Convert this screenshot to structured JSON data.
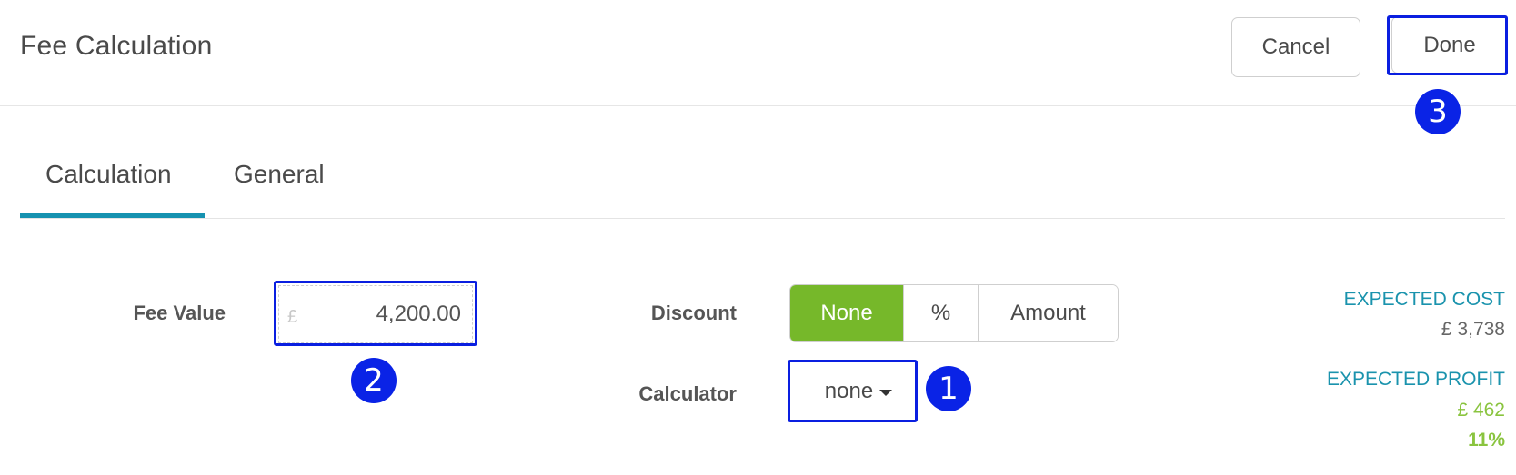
{
  "header": {
    "title": "Fee Calculation",
    "cancel_label": "Cancel",
    "done_label": "Done"
  },
  "tabs": [
    {
      "label": "Calculation",
      "active": true
    },
    {
      "label": "General",
      "active": false
    }
  ],
  "form": {
    "fee_value_label": "Fee Value",
    "fee_currency": "£",
    "fee_value": "4,200.00",
    "discount_label": "Discount",
    "discount_options": [
      "None",
      "%",
      "Amount"
    ],
    "discount_selected": "None",
    "calculator_label": "Calculator",
    "calculator_value": "none"
  },
  "stats": {
    "expected_cost_label": "EXPECTED COST",
    "expected_cost_value": "£ 3,738",
    "expected_profit_label": "EXPECTED PROFIT",
    "expected_profit_value": "£ 462",
    "expected_profit_pct": "11%"
  },
  "annotations": {
    "badge_1": "1",
    "badge_2": "2",
    "badge_3": "3"
  },
  "colors": {
    "accent_teal": "#1692b0",
    "selected_green": "#76b82a",
    "profit_green": "#8ac43f",
    "annotation_blue": "#0a1fe0"
  }
}
